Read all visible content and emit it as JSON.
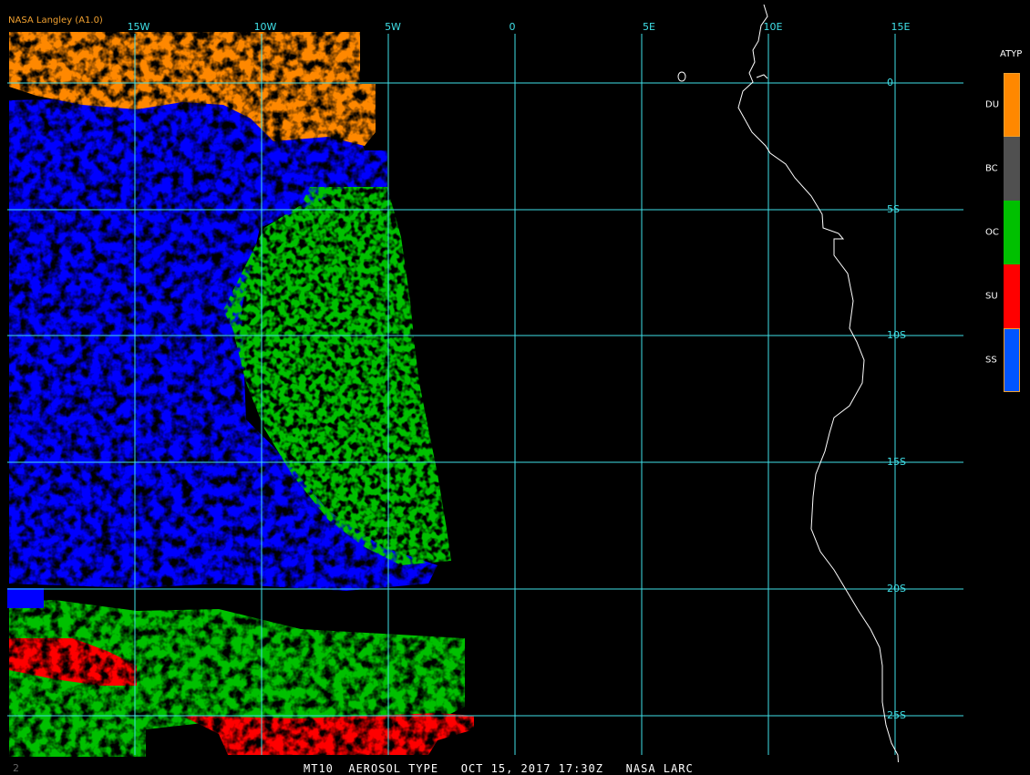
{
  "credit": "NASA Langley (A1.0)",
  "colors": {
    "grid": "#40e0e8",
    "coast": "#ffffff",
    "du": "#ff8800",
    "bc": "#505050",
    "oc": "#00c000",
    "su": "#ff0000",
    "ss": "#0000ff",
    "legend_ss": "#0055ff",
    "credit": "#f0a030"
  },
  "longitude_labels": [
    "15W",
    "10W",
    "5W",
    "0",
    "5E",
    "10E",
    "15E"
  ],
  "latitude_labels": [
    "0",
    "5S",
    "10S",
    "15S",
    "20S",
    "25S"
  ],
  "legend": {
    "title": "ATYP",
    "items": [
      {
        "code": "DU",
        "color": "#ff8800"
      },
      {
        "code": "BC",
        "color": "#505050"
      },
      {
        "code": "OC",
        "color": "#00c000"
      },
      {
        "code": "SU",
        "color": "#ff0000"
      },
      {
        "code": "SS",
        "color": "#0055ff"
      }
    ]
  },
  "status_bar": "MT10  AEROSOL TYPE   OCT 15, 2017 17:30Z   NASA LARC",
  "corner_mark": "2"
}
